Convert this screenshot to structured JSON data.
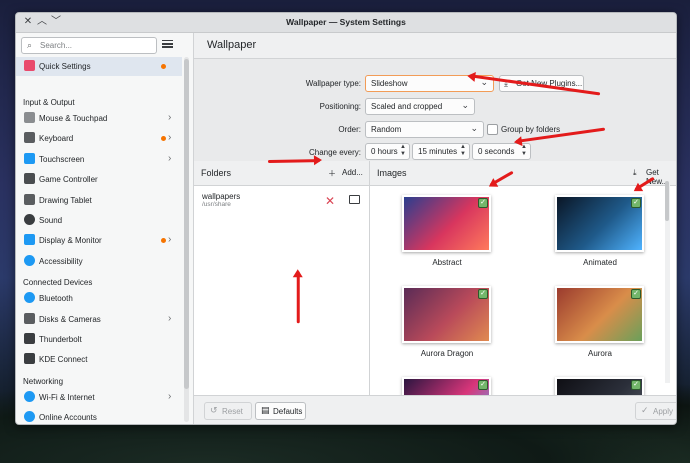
{
  "window": {
    "title": "Wallpaper — System Settings"
  },
  "titlebar_icons": {
    "close": "close-icon",
    "minimize": "chevron-up-icon",
    "maximize": "chevron-down-icon"
  },
  "search": {
    "placeholder": "Search..."
  },
  "page": {
    "heading": "Wallpaper"
  },
  "sidebar": {
    "top": {
      "label": "Quick Settings"
    },
    "sections": [
      {
        "title": "Input & Output",
        "items": [
          {
            "label": "Mouse & Touchpad",
            "chevron": true,
            "dot": false,
            "icon": "mouse-icon"
          },
          {
            "label": "Keyboard",
            "chevron": true,
            "dot": true,
            "icon": "keyboard-icon"
          },
          {
            "label": "Touchscreen",
            "chevron": true,
            "dot": false,
            "icon": "touchscreen-icon"
          },
          {
            "label": "Game Controller",
            "chevron": false,
            "dot": false,
            "icon": "gamepad-icon"
          },
          {
            "label": "Drawing Tablet",
            "chevron": false,
            "dot": false,
            "icon": "tablet-icon"
          },
          {
            "label": "Sound",
            "chevron": false,
            "dot": false,
            "icon": "speaker-icon"
          },
          {
            "label": "Display & Monitor",
            "chevron": true,
            "dot": true,
            "icon": "monitor-icon"
          },
          {
            "label": "Accessibility",
            "chevron": false,
            "dot": false,
            "icon": "accessibility-icon"
          }
        ]
      },
      {
        "title": "Connected Devices",
        "items": [
          {
            "label": "Bluetooth",
            "chevron": false,
            "dot": false,
            "icon": "bluetooth-icon"
          },
          {
            "label": "Disks & Cameras",
            "chevron": true,
            "dot": false,
            "icon": "disk-icon"
          },
          {
            "label": "Thunderbolt",
            "chevron": false,
            "dot": false,
            "icon": "thunderbolt-icon"
          },
          {
            "label": "KDE Connect",
            "chevron": false,
            "dot": false,
            "icon": "kdeconnect-icon"
          }
        ]
      },
      {
        "title": "Networking",
        "items": [
          {
            "label": "Wi-Fi & Internet",
            "chevron": true,
            "dot": false,
            "icon": "wifi-icon"
          },
          {
            "label": "Online Accounts",
            "chevron": false,
            "dot": false,
            "icon": "accounts-icon"
          }
        ]
      }
    ]
  },
  "settings": {
    "wallpaper_type_label": "Wallpaper type:",
    "wallpaper_type_value": "Slideshow",
    "get_new_plugins": "Get New Plugins...",
    "positioning_label": "Positioning:",
    "positioning_value": "Scaled and cropped",
    "order_label": "Order:",
    "order_value": "Random",
    "group_by_folders": "Group by folders",
    "change_every_label": "Change every:",
    "hours": "0 hours",
    "minutes": "15 minutes",
    "seconds": "0 seconds"
  },
  "folders": {
    "title": "Folders",
    "add": "Add...",
    "entries": [
      {
        "name": "wallpapers",
        "path": "/usr/share"
      }
    ]
  },
  "images": {
    "title": "Images",
    "get_new": "Get New...",
    "items": [
      {
        "label": "Abstract",
        "checked": true,
        "colors": [
          "#2a3e8f",
          "#d8365e",
          "#ff7a5c"
        ]
      },
      {
        "label": "Animated",
        "checked": true,
        "colors": [
          "#0a1626",
          "#1f5a8a",
          "#4fb3ff"
        ]
      },
      {
        "label": "Aurora Dragon",
        "checked": true,
        "colors": [
          "#5a2b56",
          "#b94a5a",
          "#e08a50"
        ]
      },
      {
        "label": "Aurora",
        "checked": true,
        "colors": [
          "#9b3b2e",
          "#d98d4a",
          "#6aa05a"
        ]
      },
      {
        "label": "",
        "checked": true,
        "colors": [
          "#2b1540",
          "#d8367a",
          "#4fb3ff"
        ]
      },
      {
        "label": "",
        "checked": true,
        "colors": [
          "#0f0f14",
          "#2b2f3a",
          "#5b5f6a"
        ]
      }
    ]
  },
  "footer": {
    "reset": "Reset",
    "defaults": "Defaults",
    "apply": "Apply"
  },
  "colors": {
    "accent": "#3daee9",
    "notify_dot": "#f67400",
    "annotation_arrow": "#e31b1b"
  }
}
